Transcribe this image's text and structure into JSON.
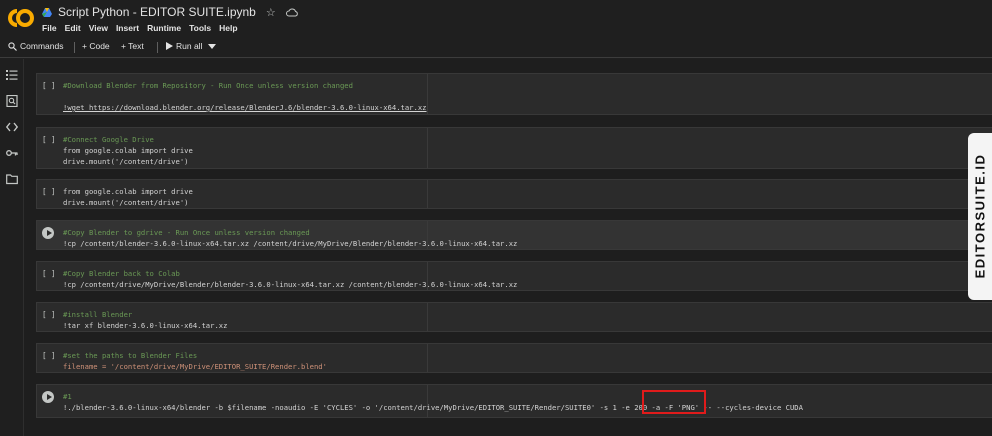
{
  "colors": {
    "background": "#1f1f1f",
    "cell_bg": "#2b2b2b",
    "comment": "#6a9955",
    "string": "#ce9178",
    "keyword": "#c586c0",
    "highlight": "#e01b1b",
    "logo_orange": "#f9ab00"
  },
  "header": {
    "logo": "CO",
    "doc_title": "Script Python - EDITOR SUITE.ipynb",
    "star_icon": "star-icon",
    "cloud_icon": "cloud-icon"
  },
  "menu": [
    "File",
    "Edit",
    "View",
    "Insert",
    "Runtime",
    "Tools",
    "Help"
  ],
  "toolbar": {
    "commands": "Commands",
    "code": "+ Code",
    "text": "+ Text",
    "run_all": "Run all"
  },
  "sidebar": [
    "toc-icon",
    "find-icon",
    "code-snippets-icon",
    "secrets-key-icon",
    "files-icon"
  ],
  "cells": [
    {
      "bracket": "[ ]",
      "lines": [
        "#Download Blender from Repository - Run Once unless version changed",
        "",
        "!wget https://download.blender.org/release/BlenderJ.6/blender-3.6.0-linux-x64.tar.xz"
      ]
    },
    {
      "bracket": "[ ]",
      "lines": [
        "#Connect Google Drive",
        "from google.colab import drive",
        "drive.mount('/content/drive')"
      ]
    },
    {
      "bracket": "[ ]",
      "lines": [
        "from google.colab import drive",
        "drive.mount('/content/drive')"
      ]
    },
    {
      "bracket": "",
      "lines": [
        "#Copy Blender to gdrive - Run Once unless version changed",
        "!cp /content/blender-3.6.0-linux-x64.tar.xz /content/drive/MyDrive/Blender/blender-3.6.0-linux-x64.tar.xz"
      ]
    },
    {
      "bracket": "[ ]",
      "lines": [
        "#Copy Blender back to Colab",
        "!cp /content/drive/MyDrive/Blender/blender-3.6.0-linux-x64.tar.xz /content/blender-3.6.0-linux-x64.tar.xz"
      ]
    },
    {
      "bracket": "[ ]",
      "lines": [
        "#install Blender",
        "!tar xf blender-3.6.0-linux-x64.tar.xz"
      ]
    },
    {
      "bracket": "[ ]",
      "lines": [
        "#set the paths to Blender Files",
        "filename = '/content/drive/MyDrive/EDITOR_SUITE/Render.blend'"
      ]
    },
    {
      "bracket": "",
      "lines": [
        "#1",
        "!./blender-3.6.0-linux-x64/blender -b $filename -noaudio -E 'CYCLES' -o '/content/drive/MyDrive/EDITOR_SUITE/Render/SUITE0' -s 1 -e 200 -a -F 'PNG' -- --cycles-device CUDA"
      ]
    }
  ],
  "watermark": "EDITORSUITE.ID"
}
